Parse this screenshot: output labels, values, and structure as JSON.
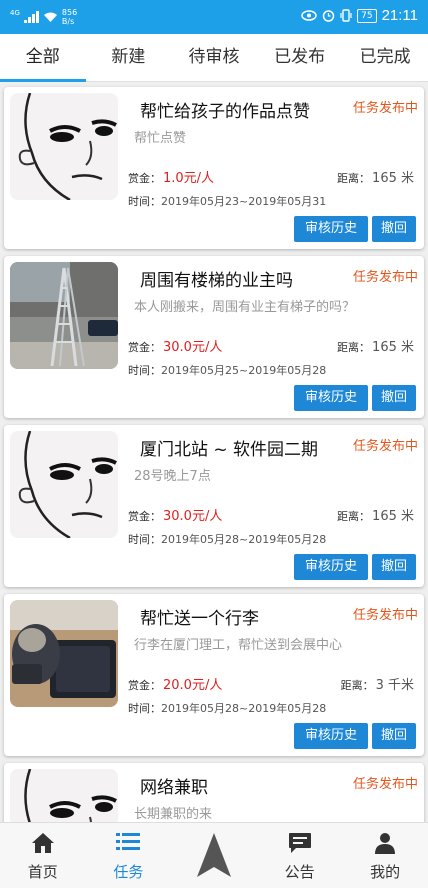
{
  "statusbar": {
    "network_speed_top": "856",
    "network_speed_bottom": "B/s",
    "signal_label": "4G",
    "battery": "75",
    "time": "21:11"
  },
  "tabs": [
    {
      "label": "全部",
      "active": true
    },
    {
      "label": "新建",
      "active": false
    },
    {
      "label": "待审核",
      "active": false
    },
    {
      "label": "已发布",
      "active": false
    },
    {
      "label": "已完成",
      "active": false
    }
  ],
  "labels": {
    "reward": "赏金：",
    "distance": "距离：",
    "time": "时间："
  },
  "tasks": [
    {
      "title": "帮忙给孩子的作品点赞",
      "status": "任务发布中",
      "description": "帮忙点赞",
      "reward": "1.0元/人",
      "distance": "165 米",
      "time": "2019年05月23~2019年05月31",
      "history_button": "审核历史",
      "revoke_button": "撤回",
      "thumb": "meme-face"
    },
    {
      "title": "周围有楼梯的业主吗",
      "status": "任务发布中",
      "description": "本人刚搬来，周围有业主有梯子的吗？",
      "reward": "30.0元/人",
      "distance": "165 米",
      "time": "2019年05月25~2019年05月28",
      "history_button": "审核历史",
      "revoke_button": "撤回",
      "thumb": "ladder-photo"
    },
    {
      "title": "厦门北站 ~ 软件园二期",
      "status": "任务发布中",
      "description": "28号晚上7点",
      "reward": "30.0元/人",
      "distance": "165 米",
      "time": "2019年05月28~2019年05月28",
      "history_button": "审核历史",
      "revoke_button": "撤回",
      "thumb": "meme-face"
    },
    {
      "title": "帮忙送一个行李",
      "status": "任务发布中",
      "description": "行李在厦门理工，帮忙送到会展中心",
      "reward": "20.0元/人",
      "distance": "3 千米",
      "time": "2019年05月28~2019年05月28",
      "history_button": "审核历史",
      "revoke_button": "撤回",
      "thumb": "luggage-photo"
    },
    {
      "title": "网络兼职",
      "status": "任务发布中",
      "description": "长期兼职的来",
      "thumb": "meme-face"
    }
  ],
  "bottomnav": [
    {
      "label": "首页",
      "icon": "home-icon",
      "active": false
    },
    {
      "label": "任务",
      "icon": "list-icon",
      "active": true
    },
    {
      "label": "",
      "icon": "navigate-arrow-icon",
      "active": false
    },
    {
      "label": "公告",
      "icon": "message-icon",
      "active": false
    },
    {
      "label": "我的",
      "icon": "person-icon",
      "active": false
    }
  ],
  "colors": {
    "primary": "#1ea0e8",
    "button": "#1e88d6",
    "status": "#e2571e",
    "reward": "#e02020"
  }
}
